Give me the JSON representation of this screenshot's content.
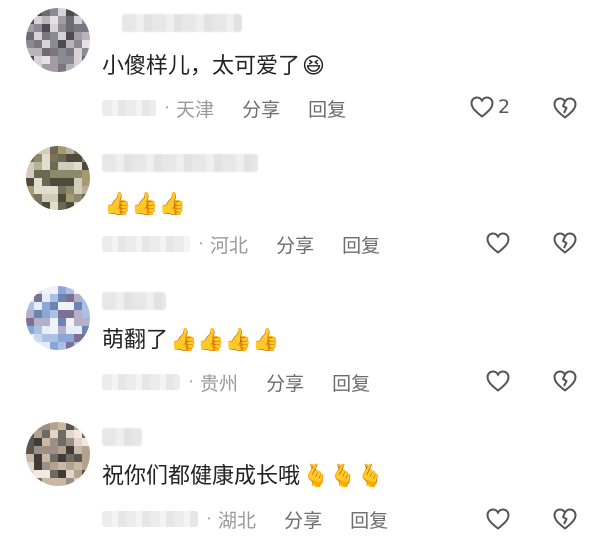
{
  "comments": [
    {
      "text": "小傻样儿，太可爱了",
      "emoji": "😆",
      "location": "天津",
      "share": "分享",
      "reply": "回复",
      "likes": "2"
    },
    {
      "text": "",
      "emoji": "👍👍👍",
      "location": "河北",
      "share": "分享",
      "reply": "回复",
      "likes": ""
    },
    {
      "text": "萌翻了",
      "emoji": "👍👍👍👍",
      "location": "贵州",
      "share": "分享",
      "reply": "回复",
      "likes": ""
    },
    {
      "text": "祝你们都健康成长哦",
      "emoji": "🫰🫰🫰",
      "location": "湖北",
      "share": "分享",
      "reply": "回复",
      "likes": ""
    }
  ],
  "colors": {
    "text": "#222222",
    "meta": "#9a9a9a",
    "action": "#6d6d6d",
    "icon": "#555555"
  },
  "icons": {
    "like": "heart-outline-icon",
    "dislike": "broken-heart-icon"
  }
}
